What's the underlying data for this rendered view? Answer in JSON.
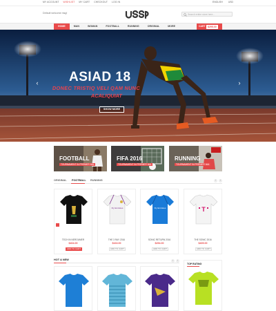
{
  "topbar": {
    "links": [
      "MY ACCOUNT",
      "WISHLIST",
      "MY CART",
      "CHECKOUT",
      "LOG IN"
    ],
    "highlight_index": 1,
    "language": "ENGLISH",
    "currency": "USD"
  },
  "header": {
    "welcome": "Default welcome msg!",
    "logo_text": "ussp",
    "search_placeholder": "Search entire store here..."
  },
  "nav": {
    "items": [
      "HOME",
      "MAN",
      "WOMAN",
      "FOOTBALL",
      "RUNNING",
      "ORIGINAL",
      "MORE"
    ],
    "active_index": 0,
    "cart_label": "CART",
    "cart_amount": "$295.00"
  },
  "hero": {
    "title": "ASIAD 18",
    "subtitle_line1": "DONEC TRISTIQ VELI QAM NUNC",
    "subtitle_line2": "ACALIQUIAT",
    "button": "SHOW MORE",
    "prev_arrow": "‹",
    "next_arrow": "›"
  },
  "banners": [
    {
      "title": "FOOTBALL",
      "subtitle": "TOURNAMENT IN PREMIER MAI"
    },
    {
      "title": "FIFA 2016",
      "subtitle": "TOURNAMENT IN PREMIER MAI"
    },
    {
      "title": "RUNNING",
      "subtitle": "TOURNAMENT IN PREMIER MAI"
    }
  ],
  "product_tabs": {
    "tabs": [
      "ORIGINAL",
      "FOOTBALL",
      "RUNNING"
    ],
    "active_index": 1
  },
  "products": [
    {
      "name": "TECH IN NEROUMER",
      "price": "$404.00",
      "button": "ADD TO CART",
      "color": "#111111"
    },
    {
      "name": "THE 3 RAY 2016",
      "price": "$163.00",
      "button": "ADD TO CART",
      "color": "#f2f2f2"
    },
    {
      "name": "SONIC RETURN 2016",
      "price": "$254.00",
      "button": "ADD TO CART",
      "color": "#1a7bd8"
    },
    {
      "name": "THE SONIC 2016",
      "price": "$405.00",
      "button": "ADD TO CART",
      "color": "#f4f4f4"
    }
  ],
  "hot_new": {
    "title": "HOT & NEW",
    "items": [
      {
        "color": "#1e7fd6"
      },
      {
        "color": "#62b6d8"
      },
      {
        "color": "#4a2a8a"
      }
    ]
  },
  "top_rating": {
    "title": "TOP RATING",
    "color": "#b8e023"
  },
  "colors": {
    "accent": "#e94b4b"
  }
}
